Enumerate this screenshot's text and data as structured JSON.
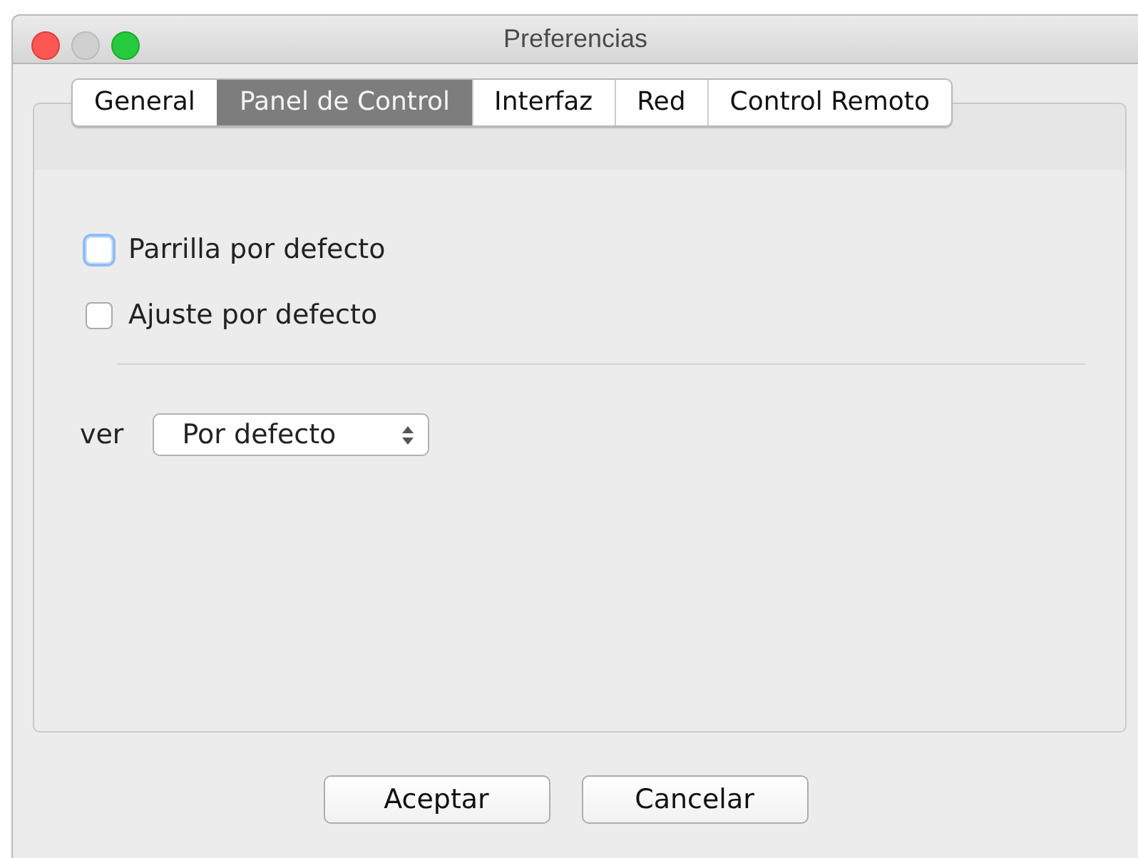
{
  "window": {
    "title": "Preferencias"
  },
  "tabs": [
    {
      "label": "General",
      "selected": false
    },
    {
      "label": "Panel de Control",
      "selected": true
    },
    {
      "label": "Interfaz",
      "selected": false
    },
    {
      "label": "Red",
      "selected": false
    },
    {
      "label": "Control Remoto",
      "selected": false
    }
  ],
  "checkboxes": [
    {
      "label": "Parrilla por defecto",
      "checked": false,
      "focused": true
    },
    {
      "label": "Ajuste por defecto",
      "checked": false,
      "focused": false
    }
  ],
  "view": {
    "label": "ver",
    "value": "Por defecto"
  },
  "buttons": [
    "Aceptar",
    "Cancelar"
  ]
}
